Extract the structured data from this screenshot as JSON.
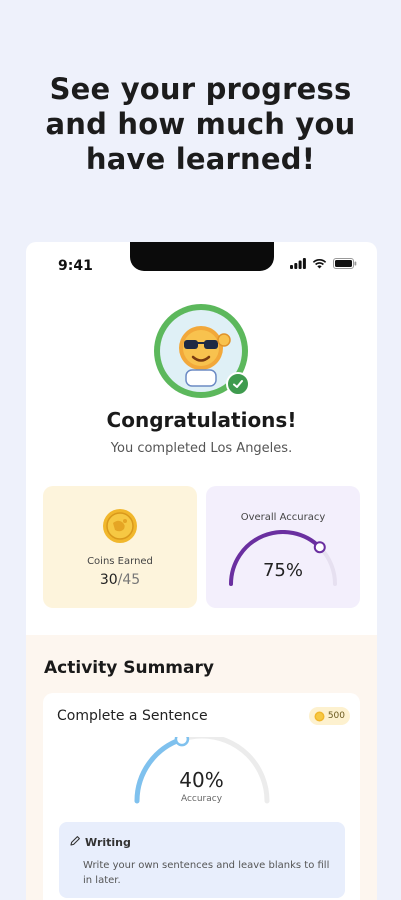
{
  "headline": {
    "line1": "See your progress",
    "line2": "and how much you",
    "line3": "have learned!"
  },
  "status_bar": {
    "time": "9:41"
  },
  "result": {
    "title": "Congratulations!",
    "subtitle": "You completed Los Angeles."
  },
  "coins": {
    "label": "Coins Earned",
    "earned": "30",
    "total": "/45"
  },
  "accuracy": {
    "label": "Overall Accuracy",
    "value_text": "75%",
    "fraction": 0.75
  },
  "summary": {
    "title": "Activity Summary",
    "activities": [
      {
        "name": "Complete a Sentence",
        "points": "500",
        "accuracy_text": "40%",
        "accuracy_label": "Accuracy",
        "fraction": 0.4,
        "mode_title": "Writing",
        "mode_desc": "Write your own sentences and leave blanks to fill in later."
      }
    ]
  },
  "colors": {
    "background": "#eef1fb",
    "avatar_ring": "#5cb85c",
    "coins_card": "#fdf4dc",
    "accuracy_card": "#f3effc",
    "accuracy_arc": "#6a2fa0",
    "activity_arc": "#7fc1ee",
    "summary_bg": "#fdf6ef",
    "writing_box": "#e8eefc"
  },
  "icons": [
    "signal-icon",
    "wifi-icon",
    "battery-icon",
    "mascot-avatar",
    "check-icon",
    "coin-icon",
    "pencil-icon"
  ]
}
